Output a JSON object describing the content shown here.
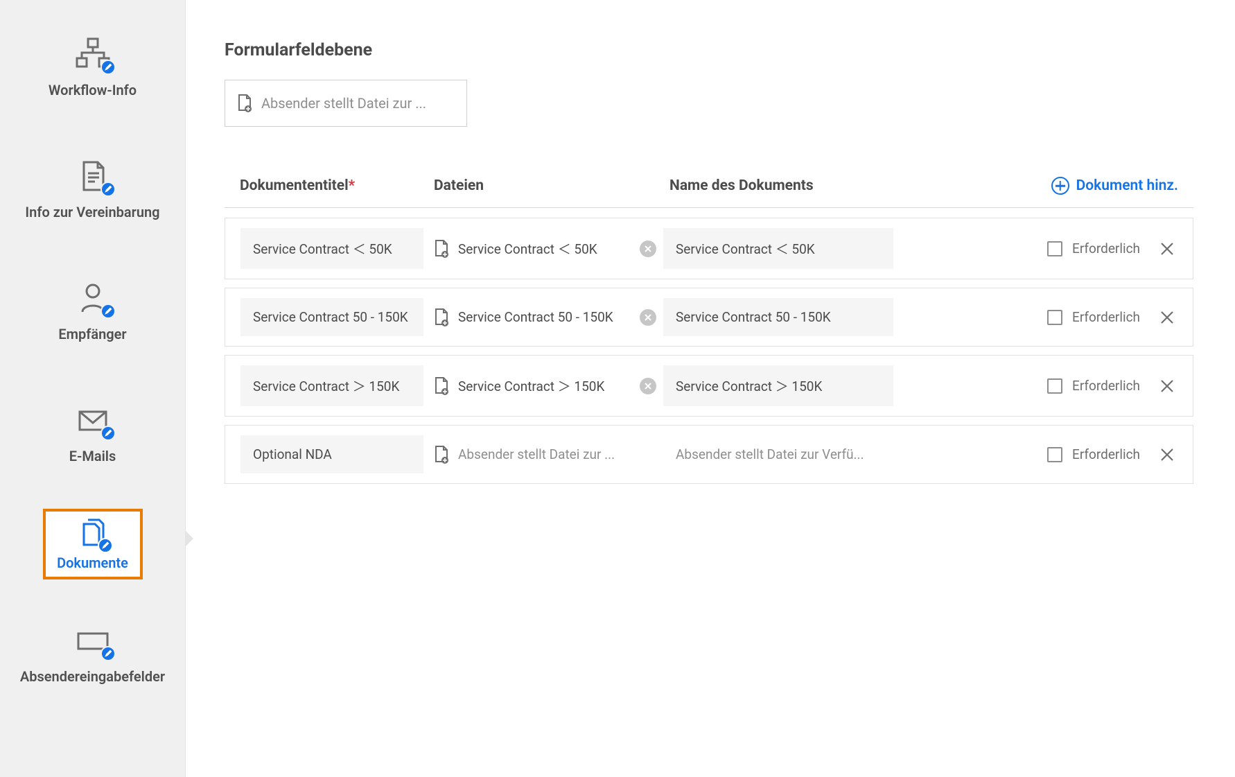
{
  "sidebar": {
    "items": [
      {
        "label": "Workflow-Info",
        "key": "workflow-info"
      },
      {
        "label": "Info zur Vereinbarung",
        "key": "agreement-info"
      },
      {
        "label": "Empfänger",
        "key": "recipients"
      },
      {
        "label": "E-Mails",
        "key": "emails"
      },
      {
        "label": "Dokumente",
        "key": "documents"
      },
      {
        "label": "Absendereingabefelder",
        "key": "sender-input-fields"
      }
    ],
    "active_index": 4
  },
  "main": {
    "section_title": "Formularfeldebene",
    "field_placeholder": "Absender stellt Datei zur ...",
    "columns": {
      "title": "Dokumententitel",
      "files": "Dateien",
      "name": "Name des Dokuments"
    },
    "add_document_label": "Dokument hinz.",
    "required_label": "Erforderlich",
    "file_placeholder": "Absender stellt Datei zur ...",
    "name_placeholder": "Absender stellt Datei zur Verfü...",
    "rows": [
      {
        "title": "Service Contract ＜ 50K",
        "file": "Service Contract ＜ 50K",
        "name": "Service Contract ＜ 50K",
        "has_file": true
      },
      {
        "title": "Service Contract 50 - 150K",
        "file": "Service Contract 50 - 150K",
        "name": "Service Contract 50 - 150K",
        "has_file": true
      },
      {
        "title": "Service Contract ＞ 150K",
        "file": "Service Contract ＞ 150K",
        "name": "Service Contract  ＞ 150K",
        "has_file": true
      },
      {
        "title": "Optional NDA",
        "file": "",
        "name": "",
        "has_file": false
      }
    ]
  },
  "colors": {
    "accent": "#1473e6",
    "highlight": "#e87b00"
  }
}
